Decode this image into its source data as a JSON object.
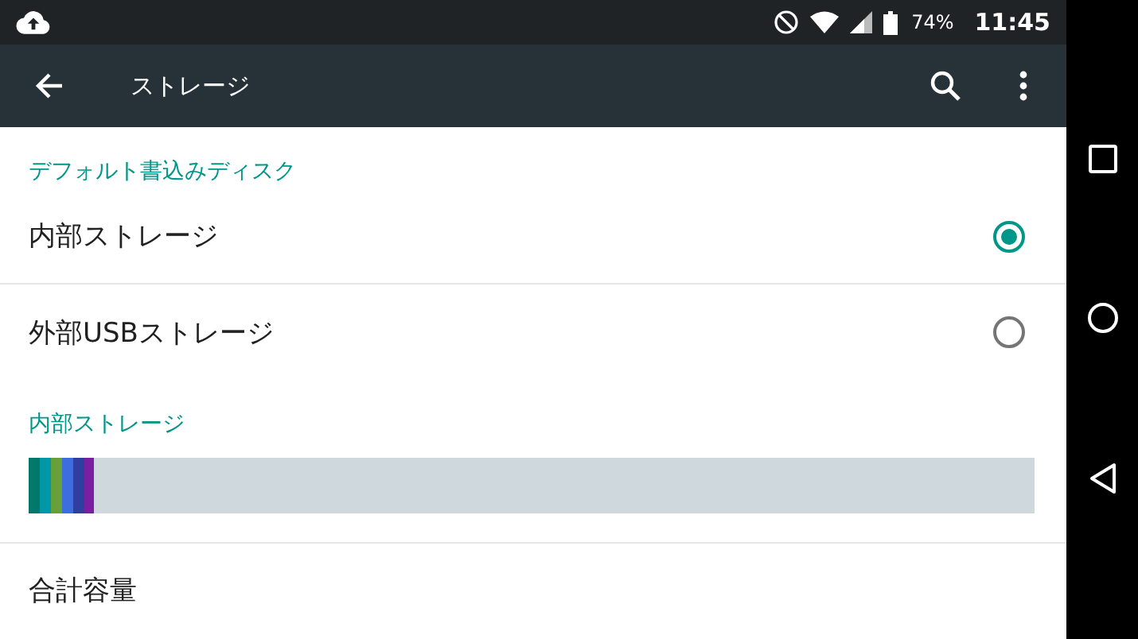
{
  "status_bar": {
    "battery": "74%",
    "time": "11:45"
  },
  "app_bar": {
    "title": "ストレージ"
  },
  "sections": [
    {
      "header": "デフォルト書込みディスク",
      "options": [
        {
          "label": "内部ストレージ",
          "selected": true
        },
        {
          "label": "外部USBストレージ",
          "selected": false
        }
      ]
    }
  ],
  "internal_storage": {
    "header": "内部ストレージ",
    "segments": [
      {
        "level": 0.011,
        "color": "#00796b"
      },
      {
        "level": 0.011,
        "color": "#0097a7"
      },
      {
        "level": 0.011,
        "color": "#689f38"
      },
      {
        "level": 0.011,
        "color": "#3d6ee0"
      },
      {
        "level": 0.011,
        "color": "#303f9f"
      },
      {
        "level": 0.01,
        "color": "#7b1fa2"
      }
    ]
  },
  "total": {
    "label": "合計容量"
  }
}
